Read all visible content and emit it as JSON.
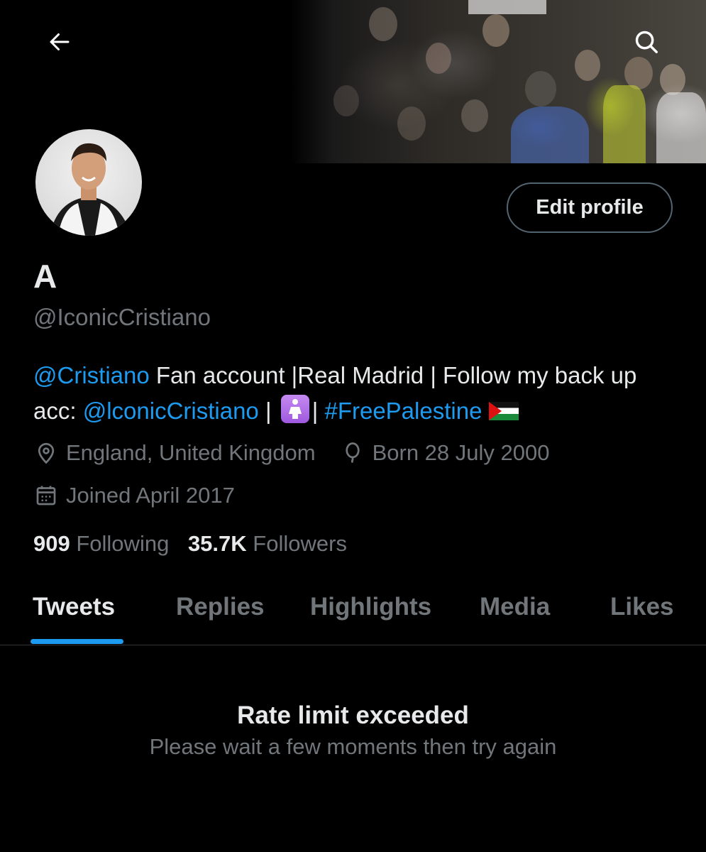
{
  "profile": {
    "display_name": "A",
    "handle": "@IconicCristiano",
    "bio": {
      "mention_1": "@Cristiano",
      "text_1": " Fan account |Real Madrid | Follow my back up acc: ",
      "mention_2": "@lconicCristiano",
      "text_2": " | ",
      "text_3": "| ",
      "hashtag": "#FreePalestine"
    },
    "location": "England, United Kingdom",
    "birthday": "Born 28 July 2000",
    "joined": "Joined April 2017",
    "following_count": "909",
    "following_label": "Following",
    "followers_count": "35.7K",
    "followers_label": "Followers"
  },
  "actions": {
    "edit_profile_label": "Edit profile"
  },
  "icons": {
    "back": "arrow-left-icon",
    "search": "search-icon",
    "location": "location-pin-icon",
    "birthday": "balloon-icon",
    "joined": "calendar-icon"
  },
  "tabs": [
    {
      "label": "Tweets",
      "active": true
    },
    {
      "label": "Replies",
      "active": false
    },
    {
      "label": "Highlights",
      "active": false
    },
    {
      "label": "Media",
      "active": false
    },
    {
      "label": "Likes",
      "active": false
    }
  ],
  "error": {
    "title": "Rate limit exceeded",
    "message": "Please wait a few moments then try again"
  },
  "colors": {
    "background": "#000000",
    "accent": "#1d9bf0",
    "text_primary": "#e7e9ea",
    "text_secondary": "#71767b"
  }
}
